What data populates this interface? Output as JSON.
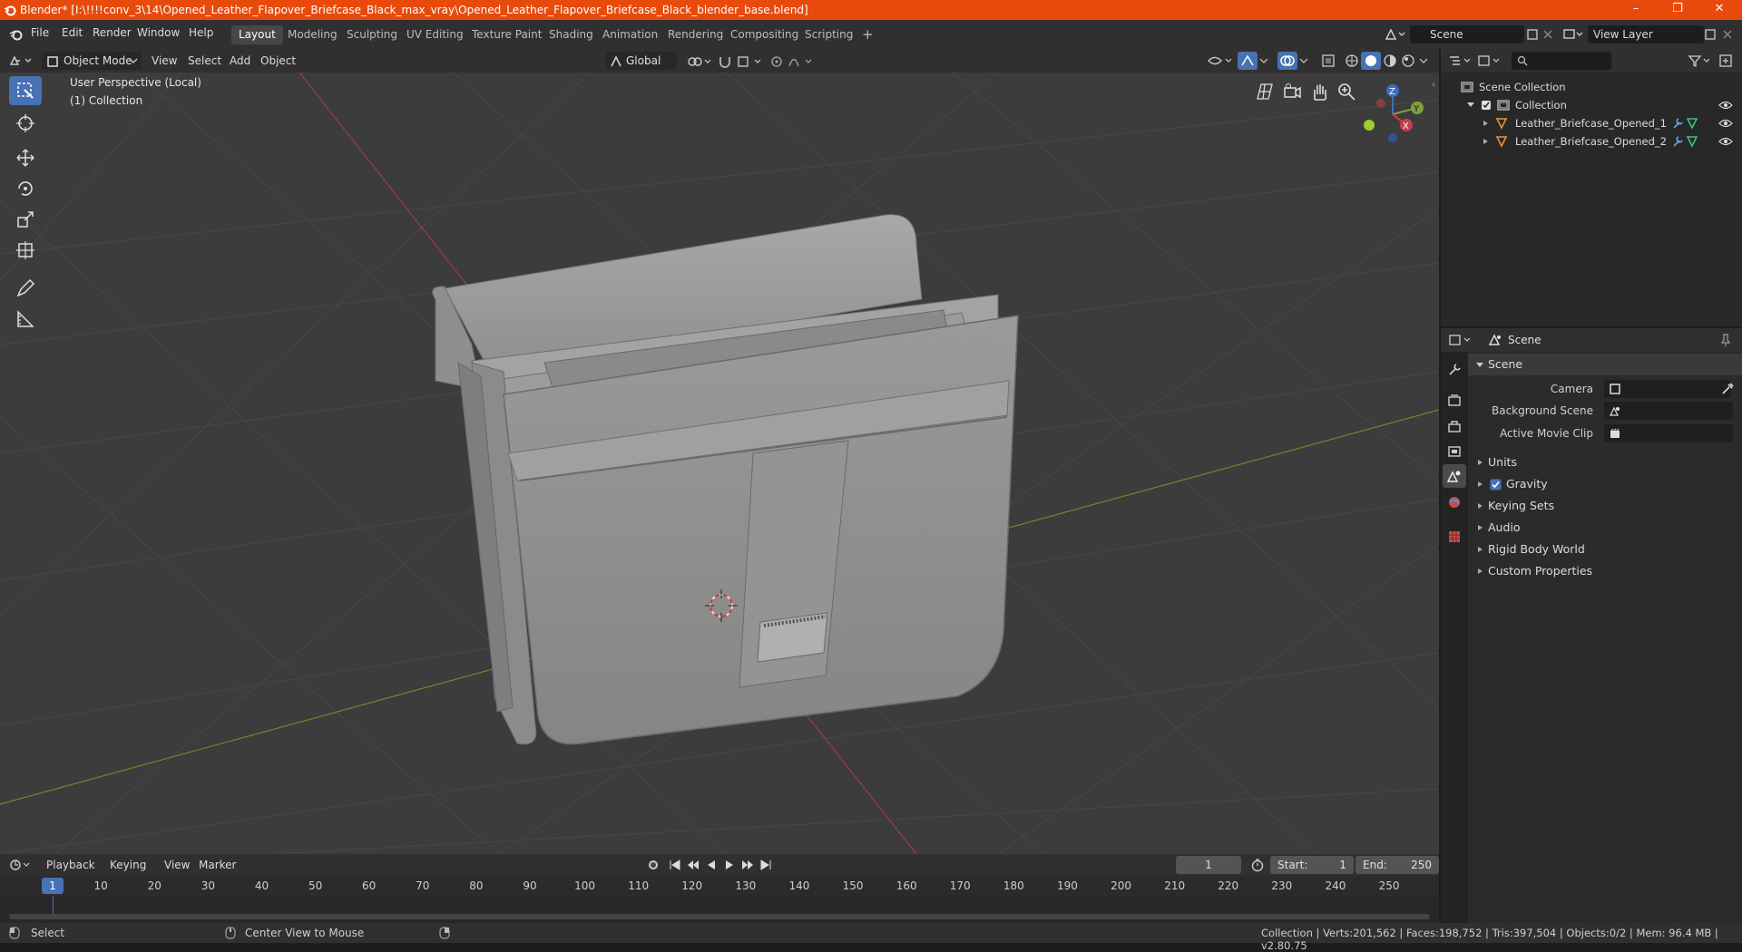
{
  "titlebar": {
    "title": "Blender* [I:\\!!!!conv_3\\14\\Opened_Leather_Flapover_Briefcase_Black_max_vray\\Opened_Leather_Flapover_Briefcase_Black_blender_base.blend]",
    "minimize": "–",
    "maximize": "❐",
    "close": "✕"
  },
  "menu": [
    "File",
    "Edit",
    "Render",
    "Window",
    "Help"
  ],
  "workspaces": [
    "Layout",
    "Modeling",
    "Sculpting",
    "UV Editing",
    "Texture Paint",
    "Shading",
    "Animation",
    "Rendering",
    "Compositing",
    "Scripting"
  ],
  "add_workspace": "+",
  "scene_field": "Scene",
  "view_layer_field": "View Layer",
  "viewport_header": {
    "mode": "Object Mode",
    "menus": [
      "View",
      "Select",
      "Add",
      "Object"
    ],
    "transform_orientation": "Global"
  },
  "viewport": {
    "perspective": "User Perspective (Local)",
    "collection": "(1) Collection",
    "gizmo": {
      "x": "X",
      "y": "Y",
      "z": "Z"
    }
  },
  "outliner": {
    "search_placeholder": "",
    "root": "Scene Collection",
    "collection": "Collection",
    "objects": [
      "Leather_Briefcase_Opened_1",
      "Leather_Briefcase_Opened_2"
    ]
  },
  "properties": {
    "header_title": "Scene",
    "panel_title": "Scene",
    "camera_label": "Camera",
    "background_scene_label": "Background Scene",
    "active_movie_clip_label": "Active Movie Clip",
    "sections": [
      "Units",
      "Gravity",
      "Keying Sets",
      "Audio",
      "Rigid Body World",
      "Custom Properties"
    ],
    "gravity_checked": true
  },
  "timeline": {
    "menus": [
      "Playback",
      "Keying",
      "View",
      "Marker"
    ],
    "current_frame": "1",
    "start_label": "Start:",
    "start_value": "1",
    "end_label": "End:",
    "end_value": "250",
    "ticks": [
      "1",
      "10",
      "20",
      "30",
      "40",
      "50",
      "60",
      "70",
      "80",
      "90",
      "100",
      "110",
      "120",
      "130",
      "140",
      "150",
      "160",
      "170",
      "180",
      "190",
      "200",
      "210",
      "220",
      "230",
      "240",
      "250"
    ]
  },
  "statusbar": {
    "select": "Select",
    "center_view": "Center View to Mouse",
    "stats": "Collection | Verts:201,562 | Faces:198,752 | Tris:397,504 | Objects:0/2 | Mem: 96.4 MB | v2.80.75"
  },
  "colors": {
    "accent": "#4772b3",
    "titlebar": "#e84a0c",
    "x_axis": "#c83c4b",
    "y_axis": "#7fa13a",
    "z_axis": "#3a6fbd",
    "object_icon": "#e8953a"
  }
}
